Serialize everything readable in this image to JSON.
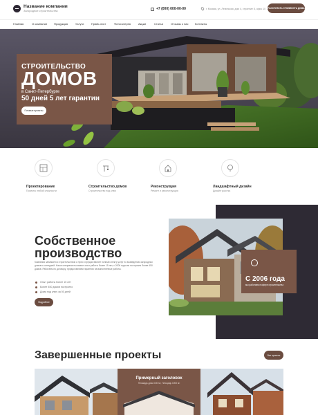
{
  "header": {
    "company_name": "Название компании",
    "company_sub": "Загородное строительство",
    "phone": "+7 (000) 000-00-00",
    "address": "г. Москва, ул. Ленинская, дом 4, строение 8, офис 10",
    "cta": "РАССЧИТАТЬ СТОИМОСТЬ ДОМА"
  },
  "nav": [
    "Главная",
    "О компании",
    "Продукция",
    "Услуги",
    "Прайс-лист",
    "Фотогалерея",
    "Акции",
    "Статьи",
    "Отзывы о нас",
    "Контакты"
  ],
  "hero": {
    "line1": "СТРОИТЕЛЬСТВО",
    "line2": "ДОМОВ",
    "line3": "в Санкт-Петербурге",
    "line4": "50 дней 5 лет гарантии",
    "button": "Готовые проекты"
  },
  "services": [
    {
      "title": "Проектирование",
      "sub": "Проекты любой сложности",
      "icon": "blueprint-icon"
    },
    {
      "title": "Строительство домов",
      "sub": "Строительство под ключ",
      "icon": "crane-icon"
    },
    {
      "title": "Реконструкция",
      "sub": "Ремонт и реконструкция",
      "icon": "house-icon"
    },
    {
      "title": "Ландшафтный дизайн",
      "sub": "Дизайн участка",
      "icon": "tree-icon"
    }
  ],
  "production": {
    "title_line1": "Собственное",
    "title_line2": "производство",
    "description": "Компания занимается строительством с нуля и предоставляет полный спектр услуг по возведению загородных домов и коттеджей. Наши специалисты имеют опыт работы более 15 лет, с 2006 года мы построили более 450 домов. Работаем по договору, предоставляем гарантию на выполненные работы.",
    "list": [
      "Опыт работы более 15 лет",
      "Более 450 домов построено",
      "Дома под ключ за 50 дней"
    ],
    "button": "Подробнее",
    "badge_title": "С 2006 года",
    "badge_sub": "мы работаем в сфере строительства"
  },
  "projects": {
    "title": "Завершенные проекты",
    "button": "Все проекты",
    "card_title": "Примерный заголовок",
    "card_sub": "Площадь дома 150 м², Площадь 1000 м²"
  },
  "colors": {
    "accent": "#6b4c40",
    "dark": "#2e2a34",
    "brown": "#7a5647"
  }
}
